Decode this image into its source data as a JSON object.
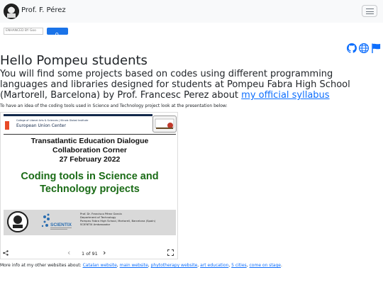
{
  "navbar": {
    "brand": "Prof. F. Pérez"
  },
  "search": {
    "placeholder": "ENHANCED BY Goo"
  },
  "social": {
    "icons": [
      "github-icon",
      "globe-icon",
      "flag-icon"
    ],
    "color": "#0d6efd"
  },
  "main": {
    "heading": "Hello Pompeu students",
    "lead_text": "You will find some projects based on codes using different programming languages and libraries designed for students at Pompeu Fabra High School (Martorell, Barcelona) by Prof. Francesc Perez about ",
    "syllabus_link": "my official syllabus",
    "intro_note": "To have an idea of the coding tools used in Science and Technology project look at the presentation below:"
  },
  "slide": {
    "uiuc_small": "College of Liberal Arts & Sciences | Illinois Global Institute",
    "eu_center": "European Union Center",
    "title_line1": "Transatlantic Education Dialogue",
    "title_line2": "Collaboration Corner",
    "title_line3": "27 February 2022",
    "big_line1": "Coding tools in Science and",
    "big_line2": "Technology projects",
    "footer_lines": [
      "Prof. Dr. Francisco Pérez García",
      "Department of Technology",
      "Pompeu Fabra High School, Martorell, Barcelona (Spain)",
      "SCIENTIX Ambassador"
    ],
    "scientix_label": "SCIENTIX"
  },
  "viewer_controls": {
    "share_icon": "share-icon",
    "prev": "‹",
    "page_indicator": "1 of 91",
    "next": "›",
    "fullscreen_icon": "fullscreen-icon"
  },
  "footer": {
    "prefix": "More info at my other websites about: ",
    "links": [
      "Catalan website",
      "main website",
      "phytotherapy website",
      "art education",
      "5 cities",
      "come on stage"
    ],
    "suffix": "."
  },
  "colors": {
    "accent": "#0d6efd",
    "slide_green": "#1a6b16",
    "navbar_bg": "#f8f9fa"
  }
}
